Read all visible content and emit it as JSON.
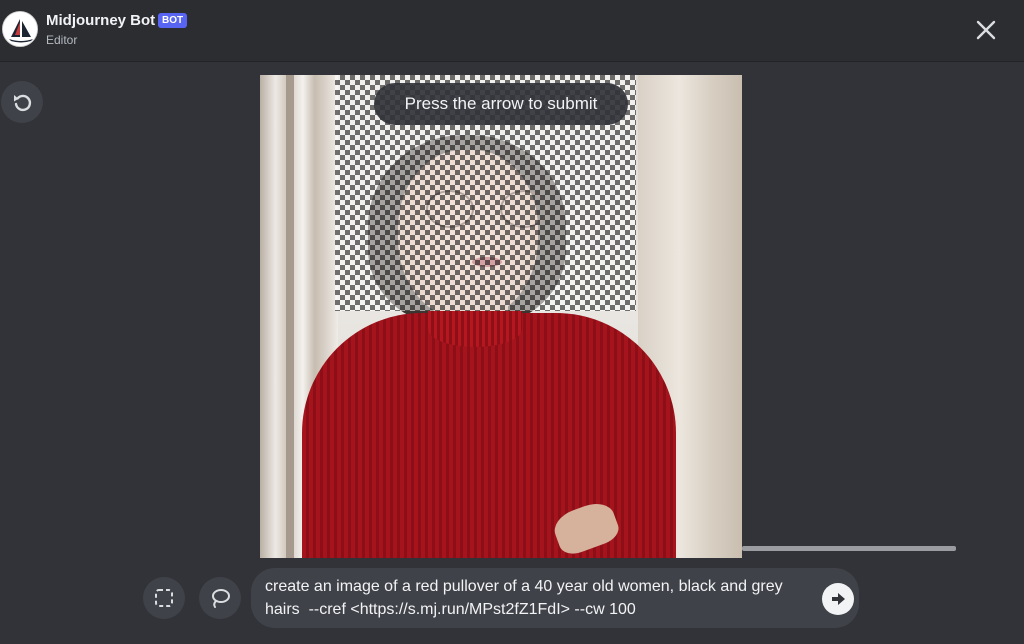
{
  "header": {
    "bot_name": "Midjourney Bot",
    "badge": "BOT",
    "subtitle": "Editor"
  },
  "icons": {
    "avatar": "midjourney-boat-icon",
    "close": "close-icon",
    "undo": "undo-icon",
    "select": "selection-rect-icon",
    "lasso": "lasso-icon",
    "submit": "arrow-right-circle-icon"
  },
  "editor": {
    "hint": "Press the arrow to submit"
  },
  "prompt": {
    "value": "create an image of a red pullover of a 40 year old women, black and grey hairs  --cref <https://s.mj.run/MPst2fZ1FdI> --cw 100"
  },
  "colors": {
    "background": "#313338",
    "header": "#2b2d31",
    "badge": "#5865f2",
    "control": "#404249"
  }
}
